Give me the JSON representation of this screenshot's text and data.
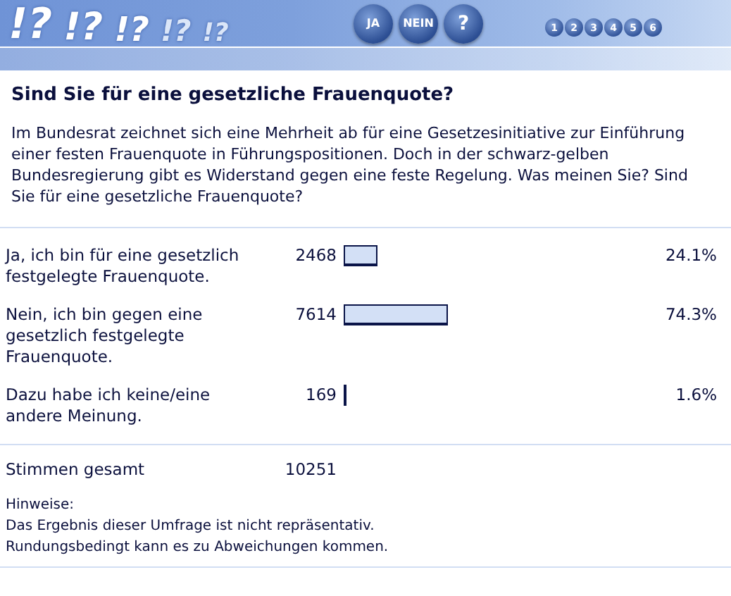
{
  "header": {
    "decorations": [
      "!?",
      "!?",
      "!?",
      "!?",
      "!?"
    ],
    "vote_buttons": [
      "JA",
      "NEIN",
      "?"
    ],
    "pages": [
      "1",
      "2",
      "3",
      "4",
      "5",
      "6"
    ]
  },
  "question": "Sind Sie für eine gesetzliche Frauenquote?",
  "intro": "Im Bundesrat zeichnet sich eine Mehrheit ab für eine Gesetzesinitiative zur Einführung einer festen Frauenquote in Führungspositionen. Doch in der schwarz-gelben Bundesregierung gibt es Widerstand gegen eine feste Regelung. Was meinen Sie? Sind Sie für eine gesetzliche Frauenquote?",
  "results": [
    {
      "answer": "Ja, ich bin für eine gesetzlich festgelegte Frauenquote.",
      "votes": "2468",
      "percent": "24.1%"
    },
    {
      "answer": "Nein, ich bin gegen eine gesetzlich festgelegte Frauenquote.",
      "votes": "7614",
      "percent": "74.3%"
    },
    {
      "answer": "Dazu habe ich keine/eine andere Meinung.",
      "votes": "169",
      "percent": "1.6%"
    }
  ],
  "total": {
    "label": "Stimmen gesamt",
    "votes": "10251"
  },
  "notes": [
    "Hinweise:",
    "Das Ergebnis dieser Umfrage ist nicht repräsentativ.",
    "Rundungsbedingt kann es zu Abweichungen kommen."
  ]
}
